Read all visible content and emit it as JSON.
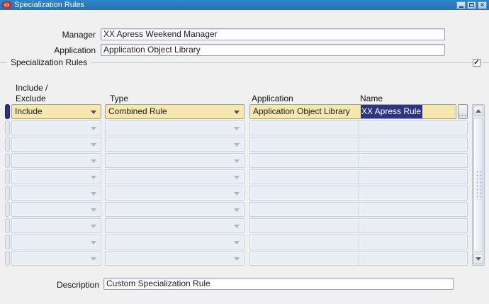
{
  "window": {
    "title": "Specialization Rules",
    "close_label": "×"
  },
  "form": {
    "manager_label": "Manager",
    "manager_value": "XX Apress Weekend Manager",
    "application_label": "Application",
    "application_value": "Application Object Library",
    "description_label": "Description",
    "description_value": "Custom Specialization Rule"
  },
  "frame": {
    "label": "Specialization Rules",
    "checkbox_checked": true,
    "checkmark": "✓"
  },
  "grid": {
    "headers": {
      "include_exclude_line1": "Include /",
      "include_exclude_line2": "Exclude",
      "type": "Type",
      "application": "Application",
      "name": "Name"
    },
    "lov_button_label": "...",
    "rows": [
      {
        "include_exclude": "Include",
        "type": "Combined Rule",
        "application": "Application Object Library",
        "name": "XX Apress Rule",
        "active": true,
        "name_selected": true
      },
      {
        "include_exclude": "",
        "type": "",
        "application": "",
        "name": "",
        "active": false
      },
      {
        "include_exclude": "",
        "type": "",
        "application": "",
        "name": "",
        "active": false
      },
      {
        "include_exclude": "",
        "type": "",
        "application": "",
        "name": "",
        "active": false
      },
      {
        "include_exclude": "",
        "type": "",
        "application": "",
        "name": "",
        "active": false
      },
      {
        "include_exclude": "",
        "type": "",
        "application": "",
        "name": "",
        "active": false
      },
      {
        "include_exclude": "",
        "type": "",
        "application": "",
        "name": "",
        "active": false
      },
      {
        "include_exclude": "",
        "type": "",
        "application": "",
        "name": "",
        "active": false
      },
      {
        "include_exclude": "",
        "type": "",
        "application": "",
        "name": "",
        "active": false
      },
      {
        "include_exclude": "",
        "type": "",
        "application": "",
        "name": "",
        "active": false
      }
    ]
  },
  "colors": {
    "titlebar_blue": "#2778BB",
    "field_yellow": "#F5E7AE",
    "selection_navy": "#2D3480",
    "record_selector_navy": "#312F8C",
    "oracle_red": "#DF362A"
  }
}
